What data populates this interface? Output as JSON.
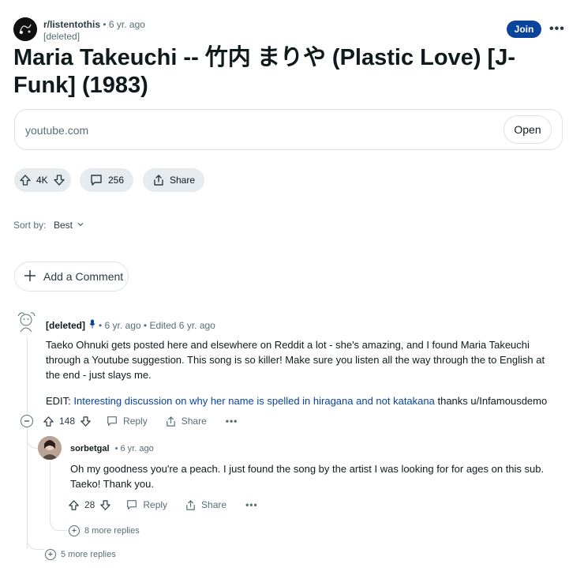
{
  "post": {
    "subreddit": "r/listentothis",
    "time": "6 yr. ago",
    "author": "[deleted]",
    "join_label": "Join",
    "more_label": "•••",
    "title": "Maria Takeuchi -- 竹内 まりや (Plastic Love) [J-Funk] (1983)",
    "link_domain": "youtube.com",
    "open_label": "Open",
    "votes": "4K",
    "comments": "256",
    "share_label": "Share"
  },
  "sort": {
    "label": "Sort by:",
    "value": "Best"
  },
  "add_comment_label": "Add a Comment",
  "comments": [
    {
      "author": "[deleted]",
      "meta": "• 6 yr. ago • Edited 6 yr. ago",
      "body": "Taeko Ohnuki gets posted here and elsewhere on Reddit a lot - she's amazing, and I found Maria Takeuchi through a Youtube suggestion. This song is so killer! Make sure you listen all the way through the to English at the end - just slays me.",
      "edit_prefix": "EDIT: ",
      "edit_link": "Interesting discussion on why her name is spelled in hiragana and not katakana",
      "edit_suffix": " thanks u/Infamousdemo",
      "votes": "148",
      "reply_label": "Reply",
      "share_label": "Share",
      "more_label": "•••",
      "more_replies": "5 more replies"
    },
    {
      "author": "sorbetgal",
      "meta": "• 6 yr. ago",
      "body": "Oh my goodness you're a peach. I just found the song by the artist I was looking for for ages on this sub. Taeko! Thank you.",
      "votes": "28",
      "reply_label": "Reply",
      "share_label": "Share",
      "more_label": "•••",
      "more_replies": "8 more replies"
    }
  ],
  "colors": {
    "accent": "#0a449b",
    "pill_bg": "#e5ebee",
    "border": "#dfe3e5",
    "muted": "#576f76"
  }
}
